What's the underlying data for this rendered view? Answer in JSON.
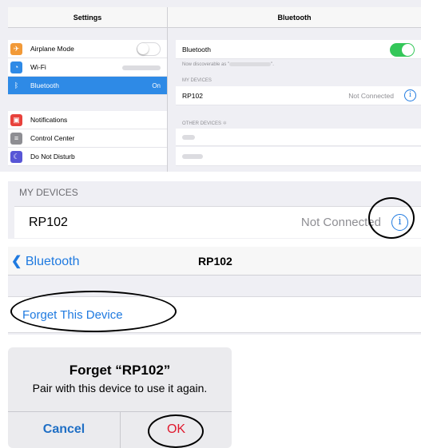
{
  "ipad": {
    "left_title": "Settings",
    "right_title": "Bluetooth",
    "left_items": [
      {
        "label": "Airplane Mode",
        "icon": "airplane-icon",
        "color": "#f29a38",
        "value": ""
      },
      {
        "label": "Wi-Fi",
        "icon": "wifi-icon",
        "color": "#2e8ae6",
        "value": ""
      },
      {
        "label": "Bluetooth",
        "icon": "bluetooth-icon",
        "color": "#2e8ae6",
        "value": "On"
      },
      {
        "label": "Notifications",
        "icon": "notifications-icon",
        "color": "#e8423c",
        "value": ""
      },
      {
        "label": "Control Center",
        "icon": "control-center-icon",
        "color": "#8e8e93",
        "value": ""
      },
      {
        "label": "Do Not Disturb",
        "icon": "moon-icon",
        "color": "#5856d6",
        "value": ""
      }
    ],
    "right": {
      "bluetooth_label": "Bluetooth",
      "discoverable_text": "Now discoverable as \"",
      "discoverable_end": "\".",
      "my_devices_header": "MY DEVICES",
      "device_name": "RP102",
      "device_status": "Not Connected",
      "other_devices_header": "OTHER DEVICES"
    }
  },
  "panel2": {
    "section_header": "MY DEVICES",
    "device_name": "RP102",
    "device_status": "Not Connected"
  },
  "panel3": {
    "back_label": "Bluetooth",
    "title": "RP102",
    "forget_label": "Forget This Device"
  },
  "alert": {
    "title": "Forget “RP102”",
    "message": "Pair with this device to use it again.",
    "cancel_label": "Cancel",
    "ok_label": "OK"
  },
  "colors": {
    "accent": "#1f7ae0",
    "toggle_on": "#34c759",
    "selected_row": "#2e8ae6",
    "destructive": "#e0182d"
  }
}
